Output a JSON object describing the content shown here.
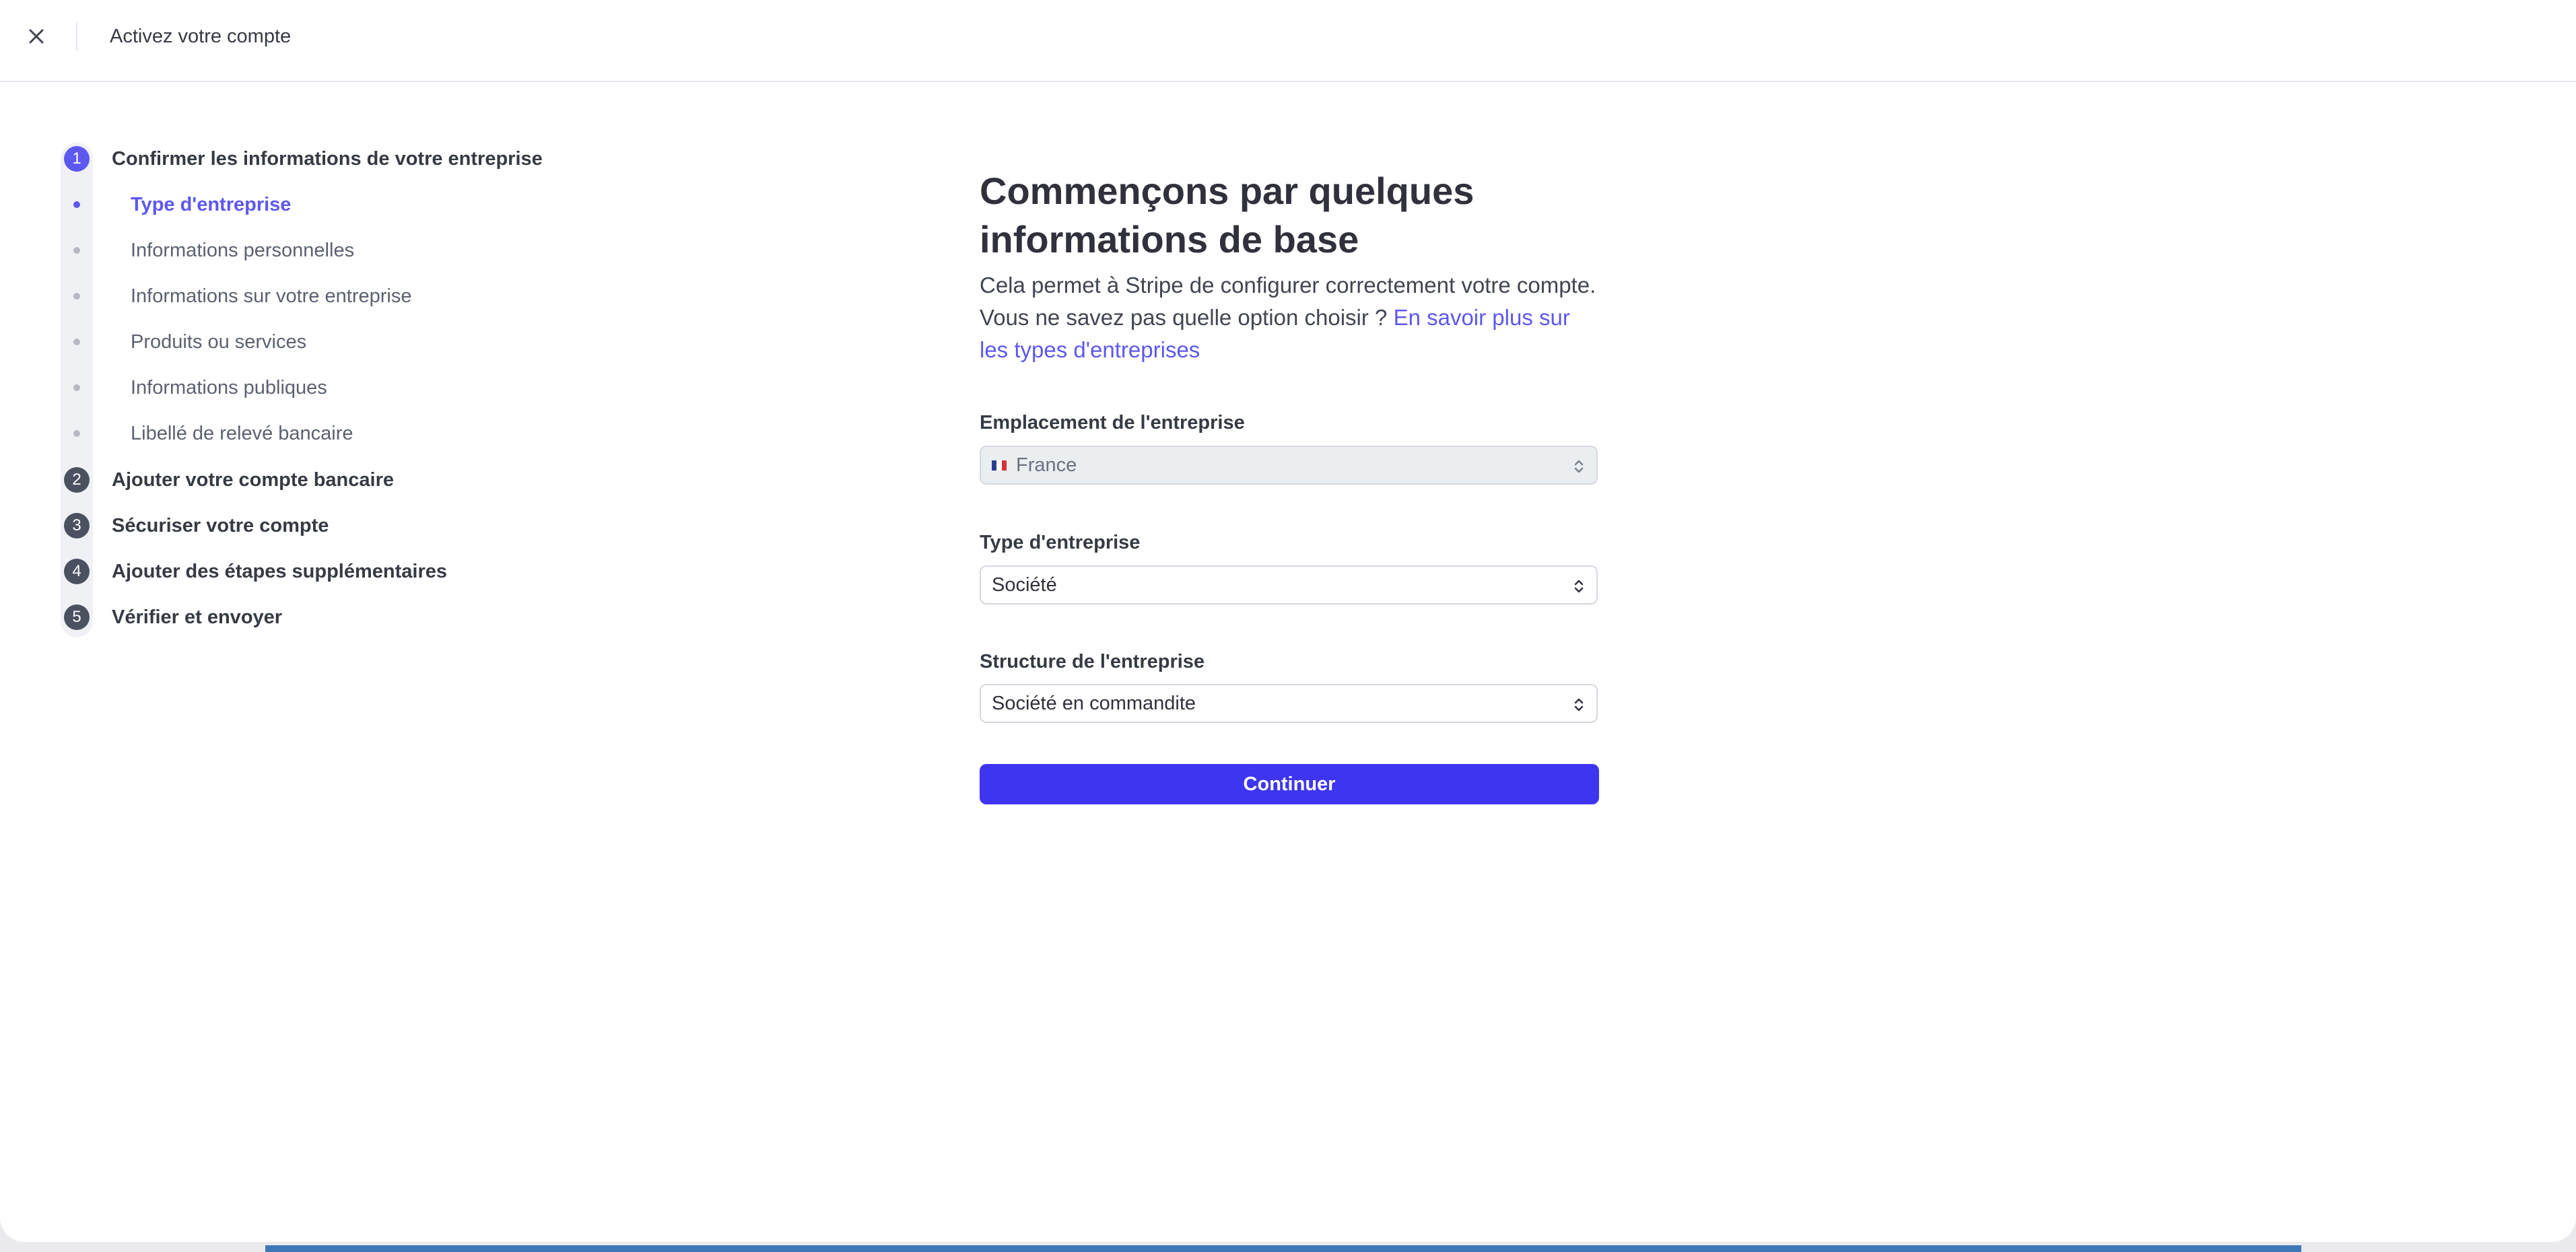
{
  "header": {
    "title": "Activez votre compte"
  },
  "sidebar": {
    "steps": [
      {
        "number": "1",
        "label": "Confirmer les informations de votre entreprise",
        "substeps": [
          {
            "label": "Type d'entreprise"
          },
          {
            "label": "Informations personnelles"
          },
          {
            "label": "Informations sur votre entreprise"
          },
          {
            "label": "Produits ou services"
          },
          {
            "label": "Informations publiques"
          },
          {
            "label": "Libellé de relevé bancaire"
          }
        ]
      },
      {
        "number": "2",
        "label": "Ajouter votre compte bancaire"
      },
      {
        "number": "3",
        "label": "Sécuriser votre compte"
      },
      {
        "number": "4",
        "label": "Ajouter des étapes supplémentaires"
      },
      {
        "number": "5",
        "label": "Vérifier et envoyer"
      }
    ]
  },
  "main": {
    "title": "Commençons par quelques informations de base",
    "description": "Cela permet à Stripe de configurer correctement votre compte. Vous ne savez pas quelle option choisir ? ",
    "learn_more_link": "En savoir plus sur les types d'entreprises",
    "fields": {
      "location": {
        "label": "Emplacement de l'entreprise",
        "value": "France"
      },
      "business_type": {
        "label": "Type d'entreprise",
        "value": "Société"
      },
      "structure": {
        "label": "Structure de l'entreprise",
        "value": "Société en commandite"
      }
    },
    "continue_label": "Continuer"
  },
  "colors": {
    "accent": "#5d58ef",
    "button": "#3d35f0",
    "text": "#30313d"
  },
  "icons": [
    "close-icon",
    "chevron-updown-icon",
    "france-flag-icon"
  ]
}
